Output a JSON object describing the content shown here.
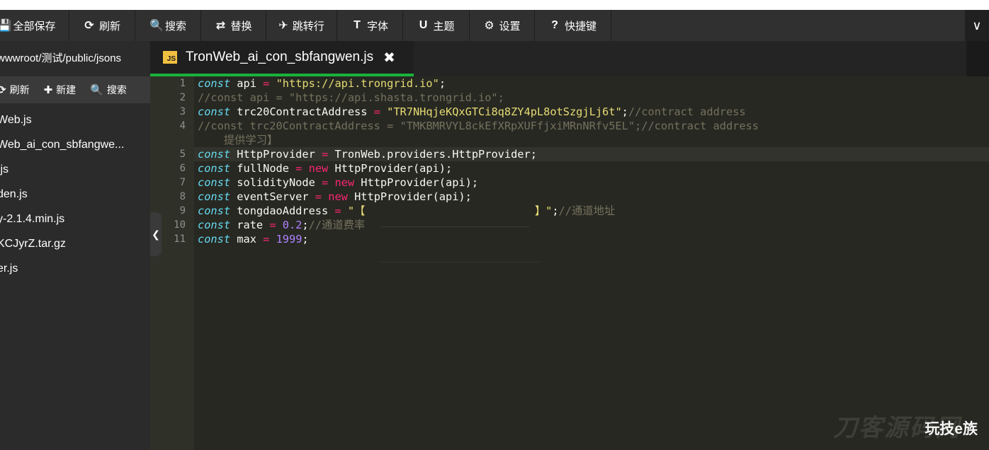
{
  "toolbar": {
    "items": [
      {
        "label": "全部保存",
        "icon": "save-icon",
        "glyph": "💾"
      },
      {
        "label": "刷新",
        "icon": "refresh-icon",
        "glyph": "⟳"
      },
      {
        "label": "搜索",
        "icon": "search-icon",
        "glyph": "🔍"
      },
      {
        "label": "替换",
        "icon": "replace-icon",
        "glyph": "⇄"
      },
      {
        "label": "跳转行",
        "icon": "pin-icon",
        "glyph": "✈"
      },
      {
        "label": "字体",
        "icon": "font-icon",
        "glyph": "T"
      },
      {
        "label": "主题",
        "icon": "theme-magnet-icon",
        "glyph": "U"
      },
      {
        "label": "设置",
        "icon": "gear-icon",
        "glyph": "⚙"
      },
      {
        "label": "快捷键",
        "icon": "help-icon",
        "glyph": "?"
      }
    ],
    "collapse_glyph": "∨"
  },
  "sidebar": {
    "path": "wwwroot/测试/public/jsons",
    "actions": [
      {
        "label": "刷新",
        "icon": "refresh-icon",
        "glyph": "⟳"
      },
      {
        "label": "新建",
        "icon": "plus-icon",
        "glyph": "✚"
      },
      {
        "label": "搜索",
        "icon": "search-icon",
        "glyph": "🔍"
      }
    ],
    "files": [
      "Web.js",
      "Web_ai_con_sbfangwe...",
      ".js",
      "den.js",
      "y-2.1.4.min.js",
      "KCJyrZ.tar.gz",
      "er.js"
    ],
    "handle_glyph": "❮"
  },
  "tab": {
    "label": "TronWeb_ai_con_sbfangwen.js",
    "icon_text": "JS",
    "close_glyph": "✖"
  },
  "editor": {
    "lines": [
      {
        "n": "1",
        "tokens": [
          [
            "kw",
            "const"
          ],
          [
            "id",
            " api "
          ],
          [
            "op",
            "="
          ],
          [
            "id",
            " "
          ],
          [
            "str",
            "\"https://api.trongrid.io\""
          ],
          [
            "id",
            ";"
          ]
        ]
      },
      {
        "n": "2",
        "tokens": [
          [
            "cm",
            "//const api = \"https://api.shasta.trongrid.io\";"
          ]
        ]
      },
      {
        "n": "3",
        "tokens": [
          [
            "kw",
            "const"
          ],
          [
            "id",
            " trc20ContractAddress "
          ],
          [
            "op",
            "="
          ],
          [
            "id",
            " "
          ],
          [
            "str",
            "\"TR7NHqjeKQxGTCi8q8ZY4pL8otSzgjLj6t\""
          ],
          [
            "id",
            ";"
          ],
          [
            "cm",
            "//contract address"
          ]
        ]
      },
      {
        "n": "4",
        "tall": true,
        "tokens": [
          [
            "cm",
            "//const trc20ContractAddress = \"TMKBMRVYL8ckEfXRpXUFfjxiMRnNRfv5EL\";//contract address\n    提供学习】"
          ]
        ]
      },
      {
        "n": "5",
        "active": true,
        "tokens": [
          [
            "kw",
            "const"
          ],
          [
            "id",
            " HttpProvider "
          ],
          [
            "op",
            "="
          ],
          [
            "id",
            " TronWeb.providers.HttpProvider;"
          ]
        ]
      },
      {
        "n": "6",
        "tokens": [
          [
            "kw",
            "const"
          ],
          [
            "id",
            " fullNode "
          ],
          [
            "op",
            "="
          ],
          [
            "id",
            " "
          ],
          [
            "op",
            "new"
          ],
          [
            "id",
            " HttpProvider(api);"
          ]
        ]
      },
      {
        "n": "7",
        "tokens": [
          [
            "kw",
            "const"
          ],
          [
            "id",
            " solidityNode "
          ],
          [
            "op",
            "="
          ],
          [
            "id",
            " "
          ],
          [
            "op",
            "new"
          ],
          [
            "id",
            " HttpProvider(api);"
          ]
        ]
      },
      {
        "n": "8",
        "tokens": [
          [
            "kw",
            "const"
          ],
          [
            "id",
            " eventServer "
          ],
          [
            "op",
            "="
          ],
          [
            "id",
            " "
          ],
          [
            "op",
            "new"
          ],
          [
            "id",
            " HttpProvider(api);"
          ]
        ]
      },
      {
        "n": "9",
        "tokens": [
          [
            "kw",
            "const"
          ],
          [
            "id",
            " tongdaoAddress "
          ],
          [
            "op",
            "="
          ],
          [
            "id",
            " "
          ],
          [
            "str",
            "\"【                          】\""
          ],
          [
            "id",
            ";"
          ],
          [
            "cm",
            "//通道地址"
          ]
        ]
      },
      {
        "n": "10",
        "tokens": [
          [
            "kw",
            "const"
          ],
          [
            "id",
            " rate "
          ],
          [
            "op",
            "="
          ],
          [
            "id",
            " "
          ],
          [
            "num",
            "0.2"
          ],
          [
            "id",
            ";"
          ],
          [
            "cm",
            "//通道费率"
          ]
        ]
      },
      {
        "n": "11",
        "tokens": [
          [
            "kw",
            "const"
          ],
          [
            "id",
            " max "
          ],
          [
            "op",
            "="
          ],
          [
            "id",
            " "
          ],
          [
            "num",
            "1999"
          ],
          [
            "id",
            ";"
          ]
        ]
      }
    ]
  },
  "watermarks": {
    "site": "刀客源码网",
    "brand": "玩技e族"
  },
  "colors": {
    "accent": "#19b23b",
    "editor_bg": "#272822",
    "keyword": "#66d9ef",
    "string": "#e6db74",
    "number": "#ae81ff",
    "operator": "#f92672",
    "comment": "#75715e"
  }
}
